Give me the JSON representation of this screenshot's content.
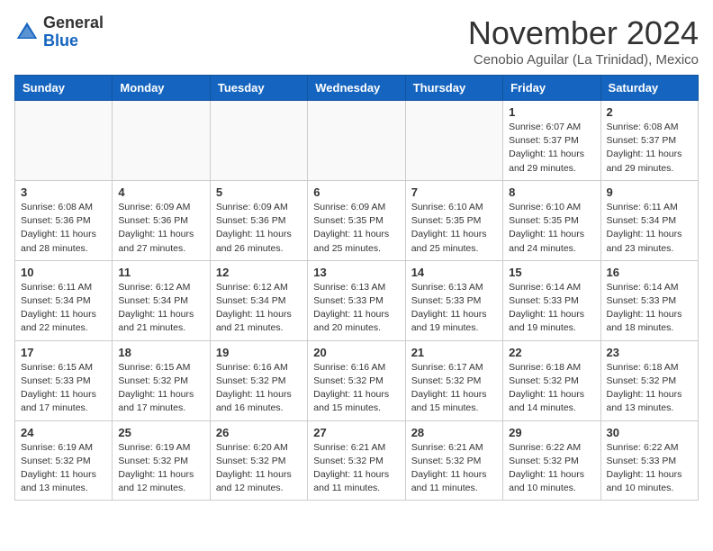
{
  "header": {
    "logo_general": "General",
    "logo_blue": "Blue",
    "month": "November 2024",
    "location": "Cenobio Aguilar (La Trinidad), Mexico"
  },
  "days_of_week": [
    "Sunday",
    "Monday",
    "Tuesday",
    "Wednesday",
    "Thursday",
    "Friday",
    "Saturday"
  ],
  "weeks": [
    [
      {
        "day": "",
        "info": ""
      },
      {
        "day": "",
        "info": ""
      },
      {
        "day": "",
        "info": ""
      },
      {
        "day": "",
        "info": ""
      },
      {
        "day": "",
        "info": ""
      },
      {
        "day": "1",
        "info": "Sunrise: 6:07 AM\nSunset: 5:37 PM\nDaylight: 11 hours\nand 29 minutes."
      },
      {
        "day": "2",
        "info": "Sunrise: 6:08 AM\nSunset: 5:37 PM\nDaylight: 11 hours\nand 29 minutes."
      }
    ],
    [
      {
        "day": "3",
        "info": "Sunrise: 6:08 AM\nSunset: 5:36 PM\nDaylight: 11 hours\nand 28 minutes."
      },
      {
        "day": "4",
        "info": "Sunrise: 6:09 AM\nSunset: 5:36 PM\nDaylight: 11 hours\nand 27 minutes."
      },
      {
        "day": "5",
        "info": "Sunrise: 6:09 AM\nSunset: 5:36 PM\nDaylight: 11 hours\nand 26 minutes."
      },
      {
        "day": "6",
        "info": "Sunrise: 6:09 AM\nSunset: 5:35 PM\nDaylight: 11 hours\nand 25 minutes."
      },
      {
        "day": "7",
        "info": "Sunrise: 6:10 AM\nSunset: 5:35 PM\nDaylight: 11 hours\nand 25 minutes."
      },
      {
        "day": "8",
        "info": "Sunrise: 6:10 AM\nSunset: 5:35 PM\nDaylight: 11 hours\nand 24 minutes."
      },
      {
        "day": "9",
        "info": "Sunrise: 6:11 AM\nSunset: 5:34 PM\nDaylight: 11 hours\nand 23 minutes."
      }
    ],
    [
      {
        "day": "10",
        "info": "Sunrise: 6:11 AM\nSunset: 5:34 PM\nDaylight: 11 hours\nand 22 minutes."
      },
      {
        "day": "11",
        "info": "Sunrise: 6:12 AM\nSunset: 5:34 PM\nDaylight: 11 hours\nand 21 minutes."
      },
      {
        "day": "12",
        "info": "Sunrise: 6:12 AM\nSunset: 5:34 PM\nDaylight: 11 hours\nand 21 minutes."
      },
      {
        "day": "13",
        "info": "Sunrise: 6:13 AM\nSunset: 5:33 PM\nDaylight: 11 hours\nand 20 minutes."
      },
      {
        "day": "14",
        "info": "Sunrise: 6:13 AM\nSunset: 5:33 PM\nDaylight: 11 hours\nand 19 minutes."
      },
      {
        "day": "15",
        "info": "Sunrise: 6:14 AM\nSunset: 5:33 PM\nDaylight: 11 hours\nand 19 minutes."
      },
      {
        "day": "16",
        "info": "Sunrise: 6:14 AM\nSunset: 5:33 PM\nDaylight: 11 hours\nand 18 minutes."
      }
    ],
    [
      {
        "day": "17",
        "info": "Sunrise: 6:15 AM\nSunset: 5:33 PM\nDaylight: 11 hours\nand 17 minutes."
      },
      {
        "day": "18",
        "info": "Sunrise: 6:15 AM\nSunset: 5:32 PM\nDaylight: 11 hours\nand 17 minutes."
      },
      {
        "day": "19",
        "info": "Sunrise: 6:16 AM\nSunset: 5:32 PM\nDaylight: 11 hours\nand 16 minutes."
      },
      {
        "day": "20",
        "info": "Sunrise: 6:16 AM\nSunset: 5:32 PM\nDaylight: 11 hours\nand 15 minutes."
      },
      {
        "day": "21",
        "info": "Sunrise: 6:17 AM\nSunset: 5:32 PM\nDaylight: 11 hours\nand 15 minutes."
      },
      {
        "day": "22",
        "info": "Sunrise: 6:18 AM\nSunset: 5:32 PM\nDaylight: 11 hours\nand 14 minutes."
      },
      {
        "day": "23",
        "info": "Sunrise: 6:18 AM\nSunset: 5:32 PM\nDaylight: 11 hours\nand 13 minutes."
      }
    ],
    [
      {
        "day": "24",
        "info": "Sunrise: 6:19 AM\nSunset: 5:32 PM\nDaylight: 11 hours\nand 13 minutes."
      },
      {
        "day": "25",
        "info": "Sunrise: 6:19 AM\nSunset: 5:32 PM\nDaylight: 11 hours\nand 12 minutes."
      },
      {
        "day": "26",
        "info": "Sunrise: 6:20 AM\nSunset: 5:32 PM\nDaylight: 11 hours\nand 12 minutes."
      },
      {
        "day": "27",
        "info": "Sunrise: 6:21 AM\nSunset: 5:32 PM\nDaylight: 11 hours\nand 11 minutes."
      },
      {
        "day": "28",
        "info": "Sunrise: 6:21 AM\nSunset: 5:32 PM\nDaylight: 11 hours\nand 11 minutes."
      },
      {
        "day": "29",
        "info": "Sunrise: 6:22 AM\nSunset: 5:32 PM\nDaylight: 11 hours\nand 10 minutes."
      },
      {
        "day": "30",
        "info": "Sunrise: 6:22 AM\nSunset: 5:33 PM\nDaylight: 11 hours\nand 10 minutes."
      }
    ]
  ]
}
